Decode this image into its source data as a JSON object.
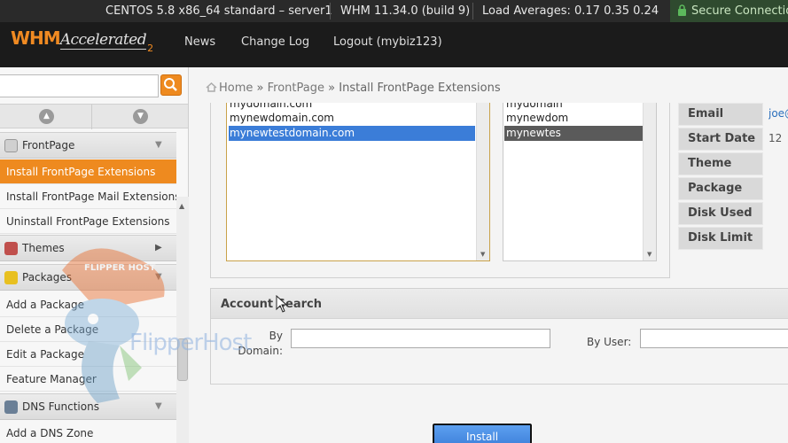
{
  "topbar": {
    "os": "CENTOS 5.8 x86_64 standard – server1",
    "version": "WHM 11.34.0 (build 9)",
    "load": "Load Averages: 0.17 0.35 0.24",
    "secure": "Secure Connection"
  },
  "header": {
    "logo_main": "WHM",
    "logo_sub": "Accelerated",
    "logo_num": "2",
    "nav": [
      "News",
      "Change Log",
      "Logout (mybiz123)"
    ]
  },
  "sidebar": {
    "groups": {
      "frontpage": "FrontPage",
      "themes": "Themes",
      "packages": "Packages",
      "dns": "DNS Functions"
    },
    "frontpage_items": [
      "Install FrontPage Extensions",
      "Install FrontPage Mail Extensions",
      "Uninstall FrontPage Extensions"
    ],
    "package_items": [
      "Add a Package",
      "Delete a Package",
      "Edit a Package",
      "Feature Manager"
    ],
    "dns_items": [
      "Add a DNS Zone"
    ]
  },
  "breadcrumb": {
    "home": "Home",
    "sep": "»",
    "section": "FrontPage",
    "page": "Install FrontPage Extensions"
  },
  "domains": [
    "mydomain.com",
    "mynewdomain.com",
    "mynewtestdomain.com"
  ],
  "users": [
    "mydomain",
    "mynewdom",
    "mynewtes"
  ],
  "info": {
    "labels": [
      "Email",
      "Start Date",
      "Theme",
      "Package",
      "Disk Used",
      "Disk Limit"
    ],
    "email_value": "joe@",
    "start_value": "12"
  },
  "account_search": {
    "title": "Account Search",
    "by_domain": "By Domain:",
    "by_user": "By User:"
  },
  "install_label": "Install",
  "watermark": {
    "text": "FlipperHost",
    "hat_text": "FLIPPER HOST"
  },
  "colors": {
    "accent": "#ee8a1f",
    "selected": "#3b7dd8"
  }
}
